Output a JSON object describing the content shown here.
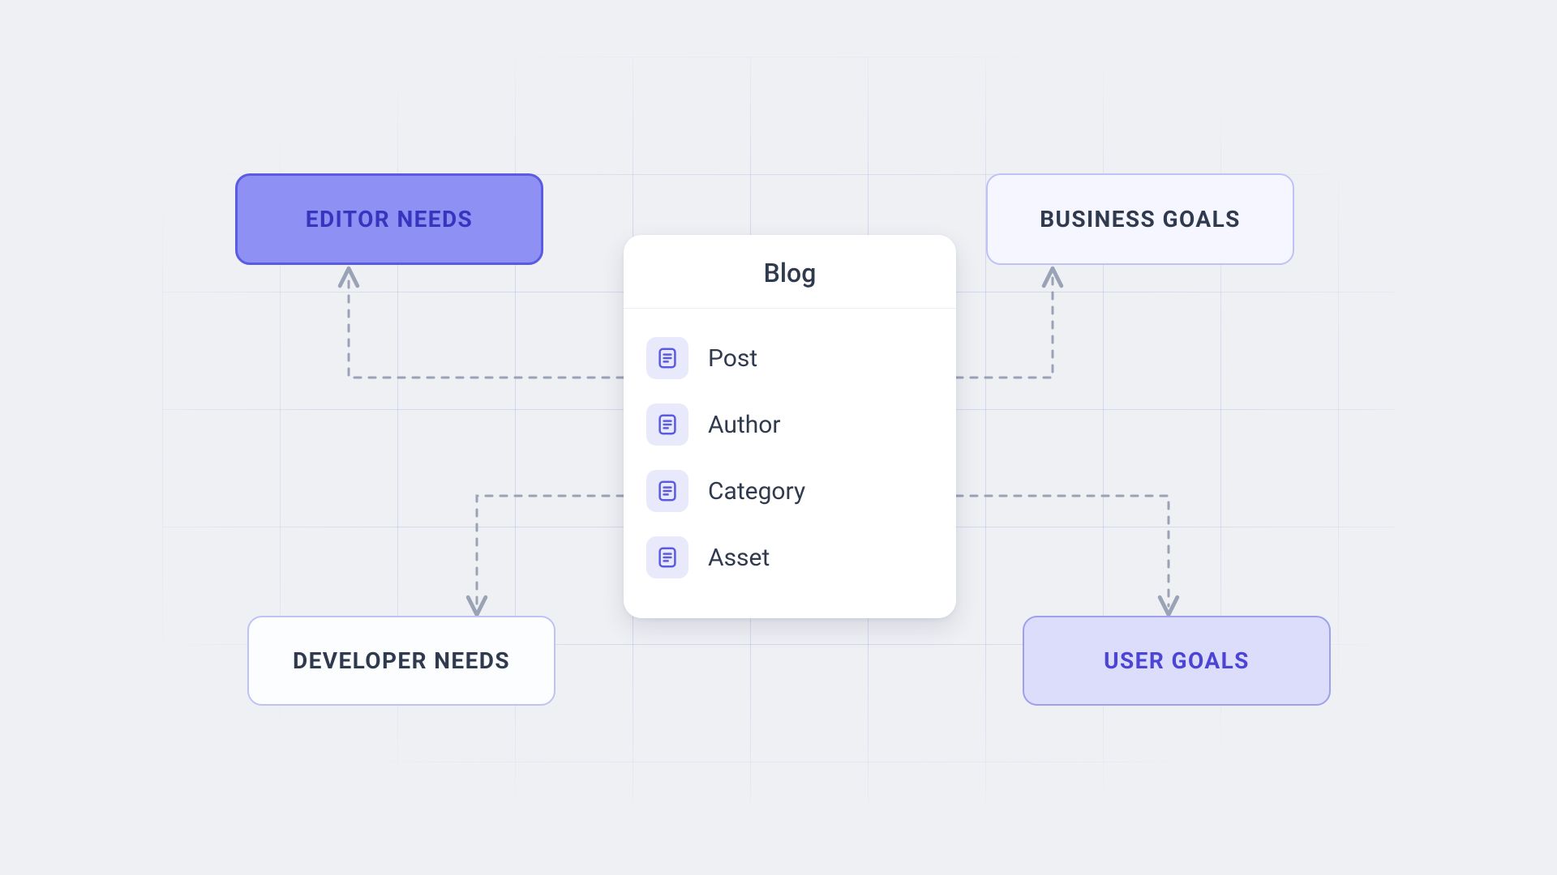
{
  "nodes": {
    "editor": "EDITOR NEEDS",
    "business": "BUSINESS GOALS",
    "developer": "DEVELOPER NEEDS",
    "user": "USER GOALS"
  },
  "card": {
    "title": "Blog",
    "items": [
      "Post",
      "Author",
      "Category",
      "Asset"
    ]
  },
  "colors": {
    "dash": "#9aa2b5",
    "accent": "#5a5be0"
  }
}
